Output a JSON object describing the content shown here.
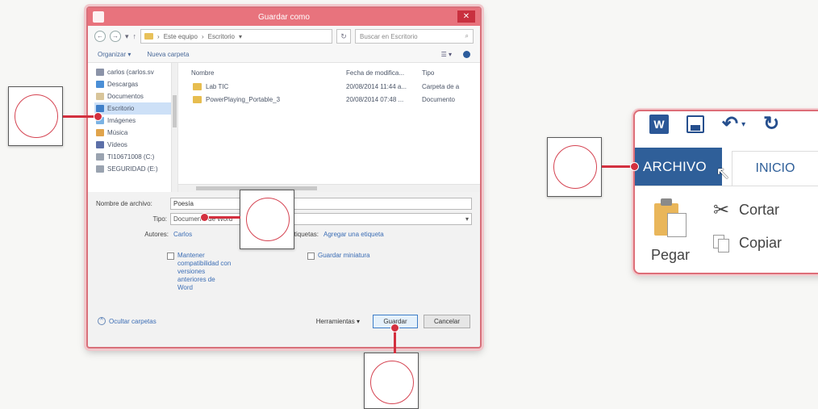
{
  "dialog": {
    "title": "Guardar como",
    "close_glyph": "✕",
    "back_glyph": "←",
    "forward_glyph": "→",
    "recent_glyph": "▾",
    "up_glyph": "↑",
    "refresh_glyph": "↻",
    "address": {
      "root": "Este equipo",
      "sep1": "›",
      "sep2": "›",
      "folder": "Escritorio",
      "dropdown": "▾"
    },
    "search_placeholder": "Buscar en Escritorio",
    "search_glyph": "⌕",
    "toolbar": {
      "organize": "Organizar ▾",
      "new_folder": "Nueva carpeta",
      "view": "☰ ▾"
    },
    "nav": [
      {
        "label": "carlos (carlos.sv"
      },
      {
        "label": "Descargas"
      },
      {
        "label": "Documentos"
      },
      {
        "label": "Escritorio"
      },
      {
        "label": "Imágenes"
      },
      {
        "label": "Música"
      },
      {
        "label": "Vídeos"
      },
      {
        "label": "TI10671008 (C:)"
      },
      {
        "label": "SEGURIDAD (E:)"
      }
    ],
    "columns": {
      "name": "Nombre",
      "date": "Fecha de modifica...",
      "type": "Tipo"
    },
    "files": [
      {
        "name": "Lab TIC",
        "date": "20/08/2014 11:44 a...",
        "type": "Carpeta de a"
      },
      {
        "name": "PowerPlaying_Portable_3",
        "date": "20/08/2014 07:48 ...",
        "type": "Documento"
      }
    ],
    "form": {
      "filename_label": "Nombre de archivo:",
      "filename_value": "Poesía",
      "type_label": "Tipo:",
      "type_value": "Documento de Word",
      "authors_label": "Autores:",
      "authors_value": "Carlos",
      "tags_label": "Etiquetas:",
      "tags_value": "Agregar una etiqueta",
      "compat_label": "Mantener compatibilidad con versiones anteriores de Word",
      "thumb_label": "Guardar miniatura"
    },
    "footer": {
      "hide_folders": "Ocultar carpetas",
      "tools": "Herramientas  ▾",
      "save": "Guardar",
      "cancel": "Cancelar"
    }
  },
  "ribbon": {
    "word_icon": "W",
    "undo_glyph": "↶",
    "undo_dropdown": "▾",
    "redo_glyph": "↻",
    "tab_file": "ARCHIVO",
    "tab_home": "INICIO",
    "cursor_glyph": "↖",
    "paste_label": "Pegar",
    "cut_glyph": "✂",
    "cut_label": "Cortar",
    "copy_label": "Copiar"
  }
}
